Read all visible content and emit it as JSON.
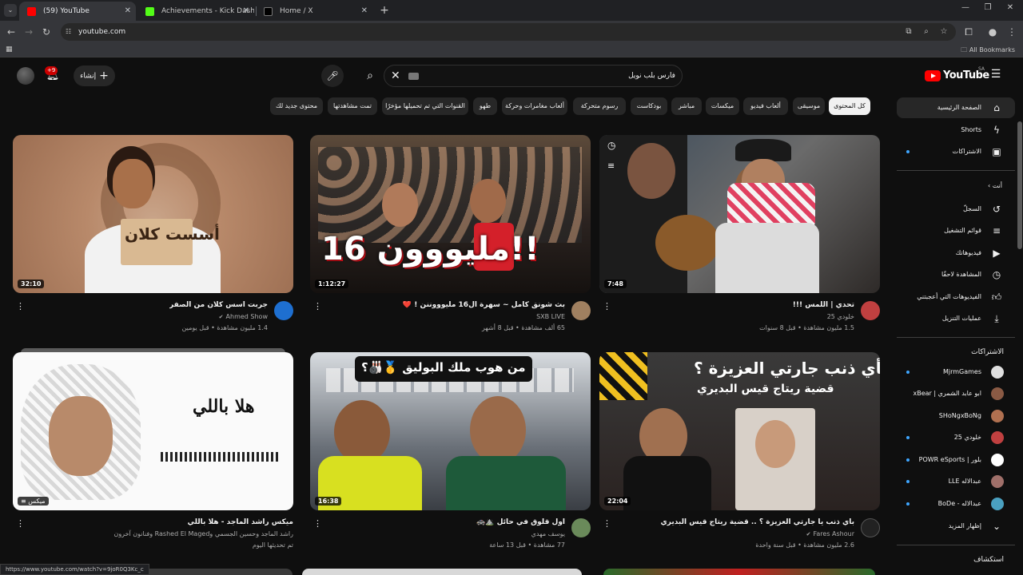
{
  "browser": {
    "tabs": [
      {
        "title": "(59) YouTube",
        "icon": "youtube-favicon",
        "active": true
      },
      {
        "title": "Achievements - Kick Dashboard",
        "icon": "kick-favicon",
        "active": false
      },
      {
        "title": "Home / X",
        "icon": "x-favicon",
        "active": false
      }
    ],
    "close_glyph": "✕",
    "new_tab_glyph": "+",
    "url": "youtube.com",
    "bookmarks_label": "All Bookmarks",
    "status_url": "https://www.youtube.com/watch?v=9joR0Q3Kc_c"
  },
  "header": {
    "logo_text": "YouTube",
    "region": "SA",
    "search_value": "فارس بلب نويل",
    "create_label": "إنشاء",
    "notifications_badge": "+9"
  },
  "chips": [
    "كل المحتوى",
    "موسيقى",
    "ألعاب فيديو",
    "ميكسات",
    "مباشر",
    "بودكاست",
    "رسوم متحركة",
    "ألعاب مغامرات وحركة",
    "طهو",
    "القنوات التي تم تحميلها مؤخرًا",
    "تمت مشاهدتها",
    "محتوى جديد لك"
  ],
  "sidebar": {
    "main": [
      {
        "label": "الصفحة الرئيسية",
        "icon": "home-icon"
      },
      {
        "label": "Shorts",
        "icon": "shorts-icon"
      },
      {
        "label": "الاشتراكات",
        "icon": "subscriptions-icon"
      }
    ],
    "you_heading": "أنت",
    "you_items": [
      {
        "label": "السجلّ",
        "icon": "history-icon"
      },
      {
        "label": "قوائم التشغيل",
        "icon": "playlists-icon"
      },
      {
        "label": "فيديوهاتك",
        "icon": "your-videos-icon"
      },
      {
        "label": "المشاهدة لاحقًا",
        "icon": "watch-later-icon"
      },
      {
        "label": "الفيديوهات التي أعجبتني",
        "icon": "like-icon"
      },
      {
        "label": "عمليات التنزيل",
        "icon": "download-icon"
      }
    ],
    "subs_heading": "الاشتراكات",
    "subs": [
      {
        "label": "MjrmGames",
        "color": "#e0e0e0"
      },
      {
        "label": "ابو عابد الشمري | xBear",
        "color": "#8a5a44"
      },
      {
        "label": "SHoNgxBoNg",
        "color": "#b07050"
      },
      {
        "label": "خلودي 25",
        "color": "#c04040"
      },
      {
        "label": "بلور | POWR eSports",
        "color": "#ffffff"
      },
      {
        "label": "عبدالاله LLE",
        "color": "#a0706a"
      },
      {
        "label": "عبدالاله - BoDe",
        "color": "#4aa0c0"
      }
    ],
    "show_more": "إظهار المزيد",
    "explore_heading": "استكشاف"
  },
  "videos": [
    {
      "title": "جربت أسس كلان من الصفر",
      "channel": "Ahmed Show",
      "verified": true,
      "stats": "1.4 مليون مشاهدة • قبل يومين",
      "duration": "32:10",
      "thumb_text": "أسست كلان",
      "avatar_color": "#1e6fd0"
    },
    {
      "title": "بث شونق كامل ~ سهرة ال16 مليوووننن ! ❤️",
      "channel": "SXB LIVE",
      "verified": false,
      "stats": "65 ألف مشاهدة • قبل 8 أشهر",
      "duration": "1:12:27",
      "thumb_text": "16 مليووون!!",
      "avatar_color": "#a08060"
    },
    {
      "title": "تحدي | اللمس !!!",
      "channel": "خلودي 25",
      "verified": false,
      "stats": "1.5 مليون مشاهدة • قبل 8 سنوات",
      "duration": "7:48",
      "thumb_text": "",
      "avatar_color": "#c04040"
    },
    {
      "title": "ميكس راشد الماجد - هلا باللي",
      "channel": "راشد الماجد وحسين الجسمي وRashed El Maged وفنانون آخرون",
      "verified": false,
      "stats": "تم تحديثها اليوم",
      "duration": "ميكس",
      "thumb_text": "هلا باللي",
      "avatar_color": ""
    },
    {
      "title": "اول قلوق في حائل ⛰️🚓",
      "channel": "يوسف مهدي",
      "verified": false,
      "stats": "77 مشاهدة • قبل 13 ساعة",
      "duration": "16:38",
      "thumb_text": "من هوب ملك البوليق 🥇🎳؟",
      "avatar_color": "#6a8a5a"
    },
    {
      "title": "بأي ذنب يا جارتي العزيزة ؟ .. قضية ريتاج قيس البديري",
      "channel": "Fares Ashour",
      "verified": true,
      "stats": "2.6 مليون مشاهدة • قبل سنة واحدة",
      "duration": "22:04",
      "thumb_text": "بأي ذنب جارتي العزيزة ؟",
      "thumb_sub": "قضية ريتاج قيس البديري",
      "avatar_color": "#222222"
    }
  ]
}
